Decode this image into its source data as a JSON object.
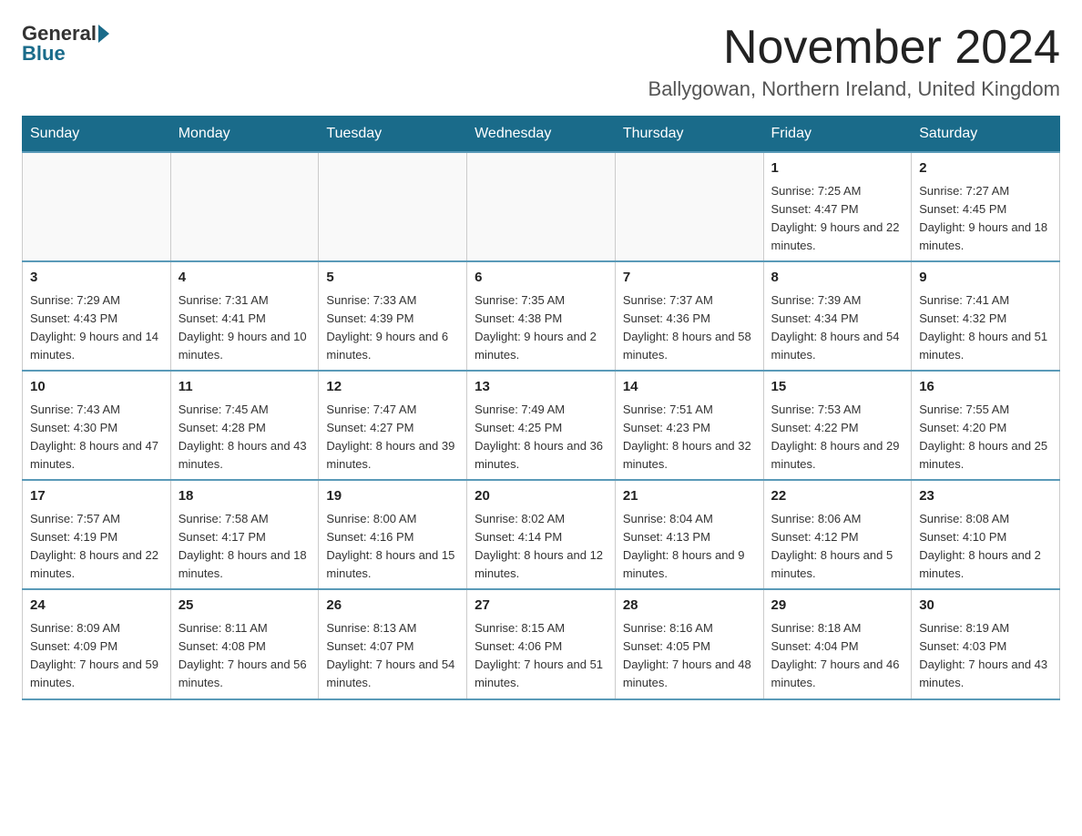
{
  "logo": {
    "general": "General",
    "blue": "Blue"
  },
  "header": {
    "month_year": "November 2024",
    "location": "Ballygowan, Northern Ireland, United Kingdom"
  },
  "weekdays": [
    "Sunday",
    "Monday",
    "Tuesday",
    "Wednesday",
    "Thursday",
    "Friday",
    "Saturday"
  ],
  "weeks": [
    [
      {
        "day": "",
        "info": ""
      },
      {
        "day": "",
        "info": ""
      },
      {
        "day": "",
        "info": ""
      },
      {
        "day": "",
        "info": ""
      },
      {
        "day": "",
        "info": ""
      },
      {
        "day": "1",
        "info": "Sunrise: 7:25 AM\nSunset: 4:47 PM\nDaylight: 9 hours and 22 minutes."
      },
      {
        "day": "2",
        "info": "Sunrise: 7:27 AM\nSunset: 4:45 PM\nDaylight: 9 hours and 18 minutes."
      }
    ],
    [
      {
        "day": "3",
        "info": "Sunrise: 7:29 AM\nSunset: 4:43 PM\nDaylight: 9 hours and 14 minutes."
      },
      {
        "day": "4",
        "info": "Sunrise: 7:31 AM\nSunset: 4:41 PM\nDaylight: 9 hours and 10 minutes."
      },
      {
        "day": "5",
        "info": "Sunrise: 7:33 AM\nSunset: 4:39 PM\nDaylight: 9 hours and 6 minutes."
      },
      {
        "day": "6",
        "info": "Sunrise: 7:35 AM\nSunset: 4:38 PM\nDaylight: 9 hours and 2 minutes."
      },
      {
        "day": "7",
        "info": "Sunrise: 7:37 AM\nSunset: 4:36 PM\nDaylight: 8 hours and 58 minutes."
      },
      {
        "day": "8",
        "info": "Sunrise: 7:39 AM\nSunset: 4:34 PM\nDaylight: 8 hours and 54 minutes."
      },
      {
        "day": "9",
        "info": "Sunrise: 7:41 AM\nSunset: 4:32 PM\nDaylight: 8 hours and 51 minutes."
      }
    ],
    [
      {
        "day": "10",
        "info": "Sunrise: 7:43 AM\nSunset: 4:30 PM\nDaylight: 8 hours and 47 minutes."
      },
      {
        "day": "11",
        "info": "Sunrise: 7:45 AM\nSunset: 4:28 PM\nDaylight: 8 hours and 43 minutes."
      },
      {
        "day": "12",
        "info": "Sunrise: 7:47 AM\nSunset: 4:27 PM\nDaylight: 8 hours and 39 minutes."
      },
      {
        "day": "13",
        "info": "Sunrise: 7:49 AM\nSunset: 4:25 PM\nDaylight: 8 hours and 36 minutes."
      },
      {
        "day": "14",
        "info": "Sunrise: 7:51 AM\nSunset: 4:23 PM\nDaylight: 8 hours and 32 minutes."
      },
      {
        "day": "15",
        "info": "Sunrise: 7:53 AM\nSunset: 4:22 PM\nDaylight: 8 hours and 29 minutes."
      },
      {
        "day": "16",
        "info": "Sunrise: 7:55 AM\nSunset: 4:20 PM\nDaylight: 8 hours and 25 minutes."
      }
    ],
    [
      {
        "day": "17",
        "info": "Sunrise: 7:57 AM\nSunset: 4:19 PM\nDaylight: 8 hours and 22 minutes."
      },
      {
        "day": "18",
        "info": "Sunrise: 7:58 AM\nSunset: 4:17 PM\nDaylight: 8 hours and 18 minutes."
      },
      {
        "day": "19",
        "info": "Sunrise: 8:00 AM\nSunset: 4:16 PM\nDaylight: 8 hours and 15 minutes."
      },
      {
        "day": "20",
        "info": "Sunrise: 8:02 AM\nSunset: 4:14 PM\nDaylight: 8 hours and 12 minutes."
      },
      {
        "day": "21",
        "info": "Sunrise: 8:04 AM\nSunset: 4:13 PM\nDaylight: 8 hours and 9 minutes."
      },
      {
        "day": "22",
        "info": "Sunrise: 8:06 AM\nSunset: 4:12 PM\nDaylight: 8 hours and 5 minutes."
      },
      {
        "day": "23",
        "info": "Sunrise: 8:08 AM\nSunset: 4:10 PM\nDaylight: 8 hours and 2 minutes."
      }
    ],
    [
      {
        "day": "24",
        "info": "Sunrise: 8:09 AM\nSunset: 4:09 PM\nDaylight: 7 hours and 59 minutes."
      },
      {
        "day": "25",
        "info": "Sunrise: 8:11 AM\nSunset: 4:08 PM\nDaylight: 7 hours and 56 minutes."
      },
      {
        "day": "26",
        "info": "Sunrise: 8:13 AM\nSunset: 4:07 PM\nDaylight: 7 hours and 54 minutes."
      },
      {
        "day": "27",
        "info": "Sunrise: 8:15 AM\nSunset: 4:06 PM\nDaylight: 7 hours and 51 minutes."
      },
      {
        "day": "28",
        "info": "Sunrise: 8:16 AM\nSunset: 4:05 PM\nDaylight: 7 hours and 48 minutes."
      },
      {
        "day": "29",
        "info": "Sunrise: 8:18 AM\nSunset: 4:04 PM\nDaylight: 7 hours and 46 minutes."
      },
      {
        "day": "30",
        "info": "Sunrise: 8:19 AM\nSunset: 4:03 PM\nDaylight: 7 hours and 43 minutes."
      }
    ]
  ]
}
